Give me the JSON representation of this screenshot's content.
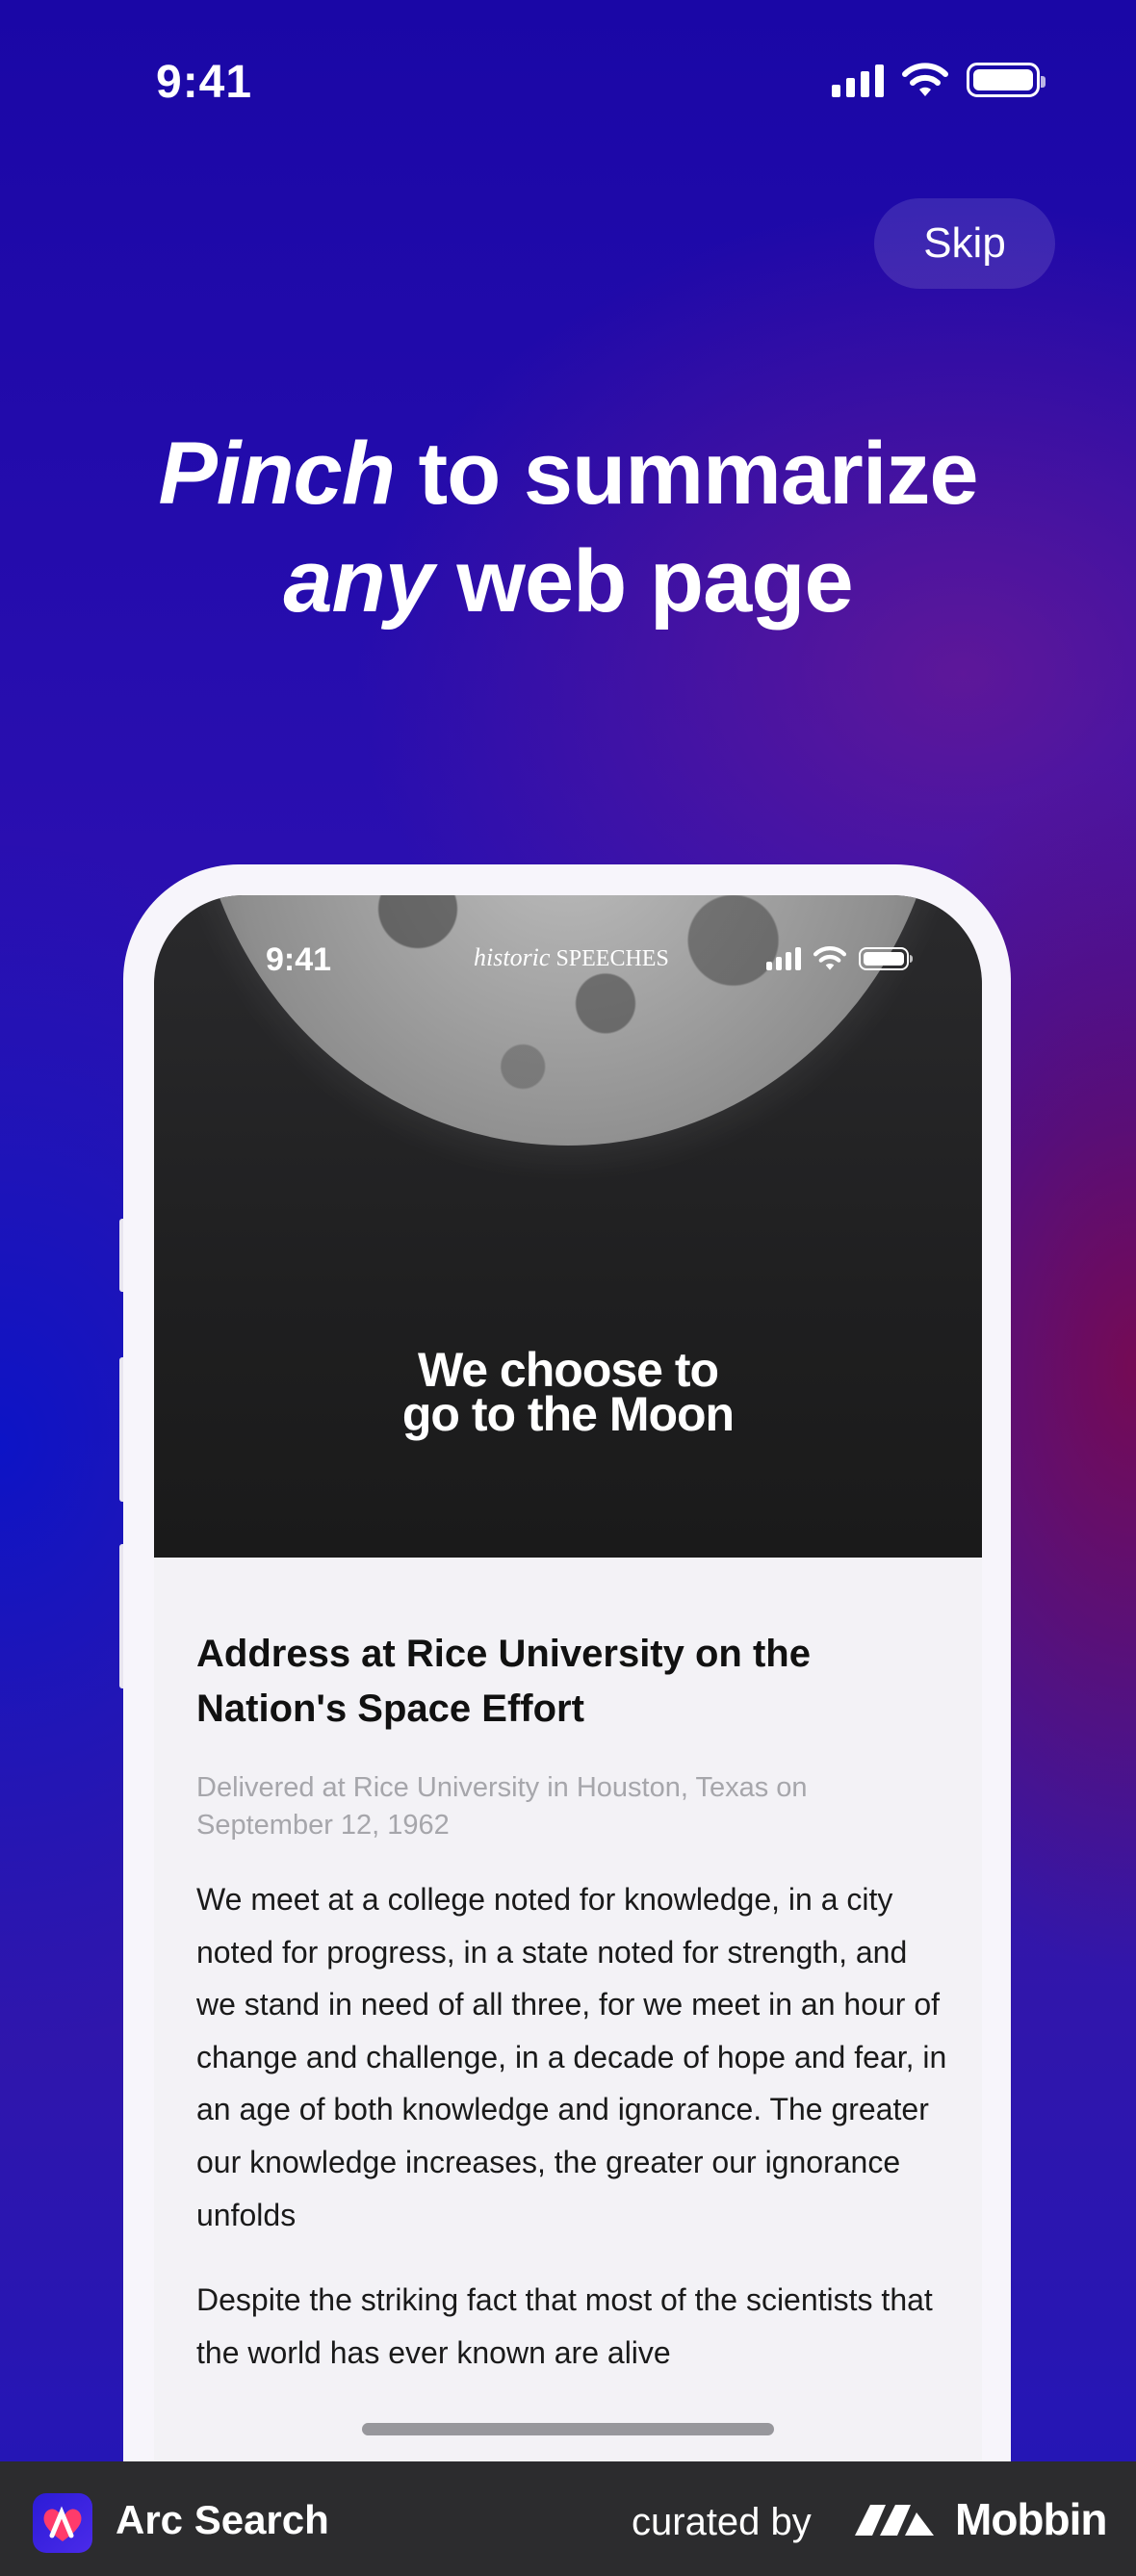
{
  "status_bar": {
    "time": "9:41"
  },
  "onboarding": {
    "skip_label": "Skip",
    "headline_line1_em": "Pinch",
    "headline_line1_rest": " to summarize",
    "headline_line2_em": "any",
    "headline_line2_rest": " web page"
  },
  "preview": {
    "status_time": "9:41",
    "site_brand_italic": "historic",
    "site_brand_caps": "SPEECHES",
    "hero_title_line1": "We choose to",
    "hero_title_line2": "go to the Moon",
    "article_title": "Address at Rice University on the Nation's Space Effort",
    "article_meta": "Delivered at Rice University in Houston, Texas on September 12, 1962",
    "paragraph_1": "We meet at a college noted for knowledge, in a city noted for progress, in a state noted for strength, and we stand in need of all three, for we meet in an hour of change and challenge, in a decade of hope and fear, in an age of both knowledge and ignorance. The greater our knowledge increases, the greater our ignorance unfolds",
    "paragraph_2": "Despite the striking fact that most of the scientists that the world has ever known are alive"
  },
  "footer": {
    "app_name": "Arc Search",
    "curated_by": "curated by",
    "brand": "Mobbin"
  },
  "icons": {
    "signal": "signal-icon",
    "wifi": "wifi-icon",
    "battery": "battery-icon",
    "app_logo": "arc-search-logo",
    "mobbin_logo": "mobbin-logo"
  },
  "colors": {
    "background_top": "#1a07a6",
    "background_accent": "#780a50",
    "footer": "#2c2c2e",
    "text": "#ffffff"
  }
}
